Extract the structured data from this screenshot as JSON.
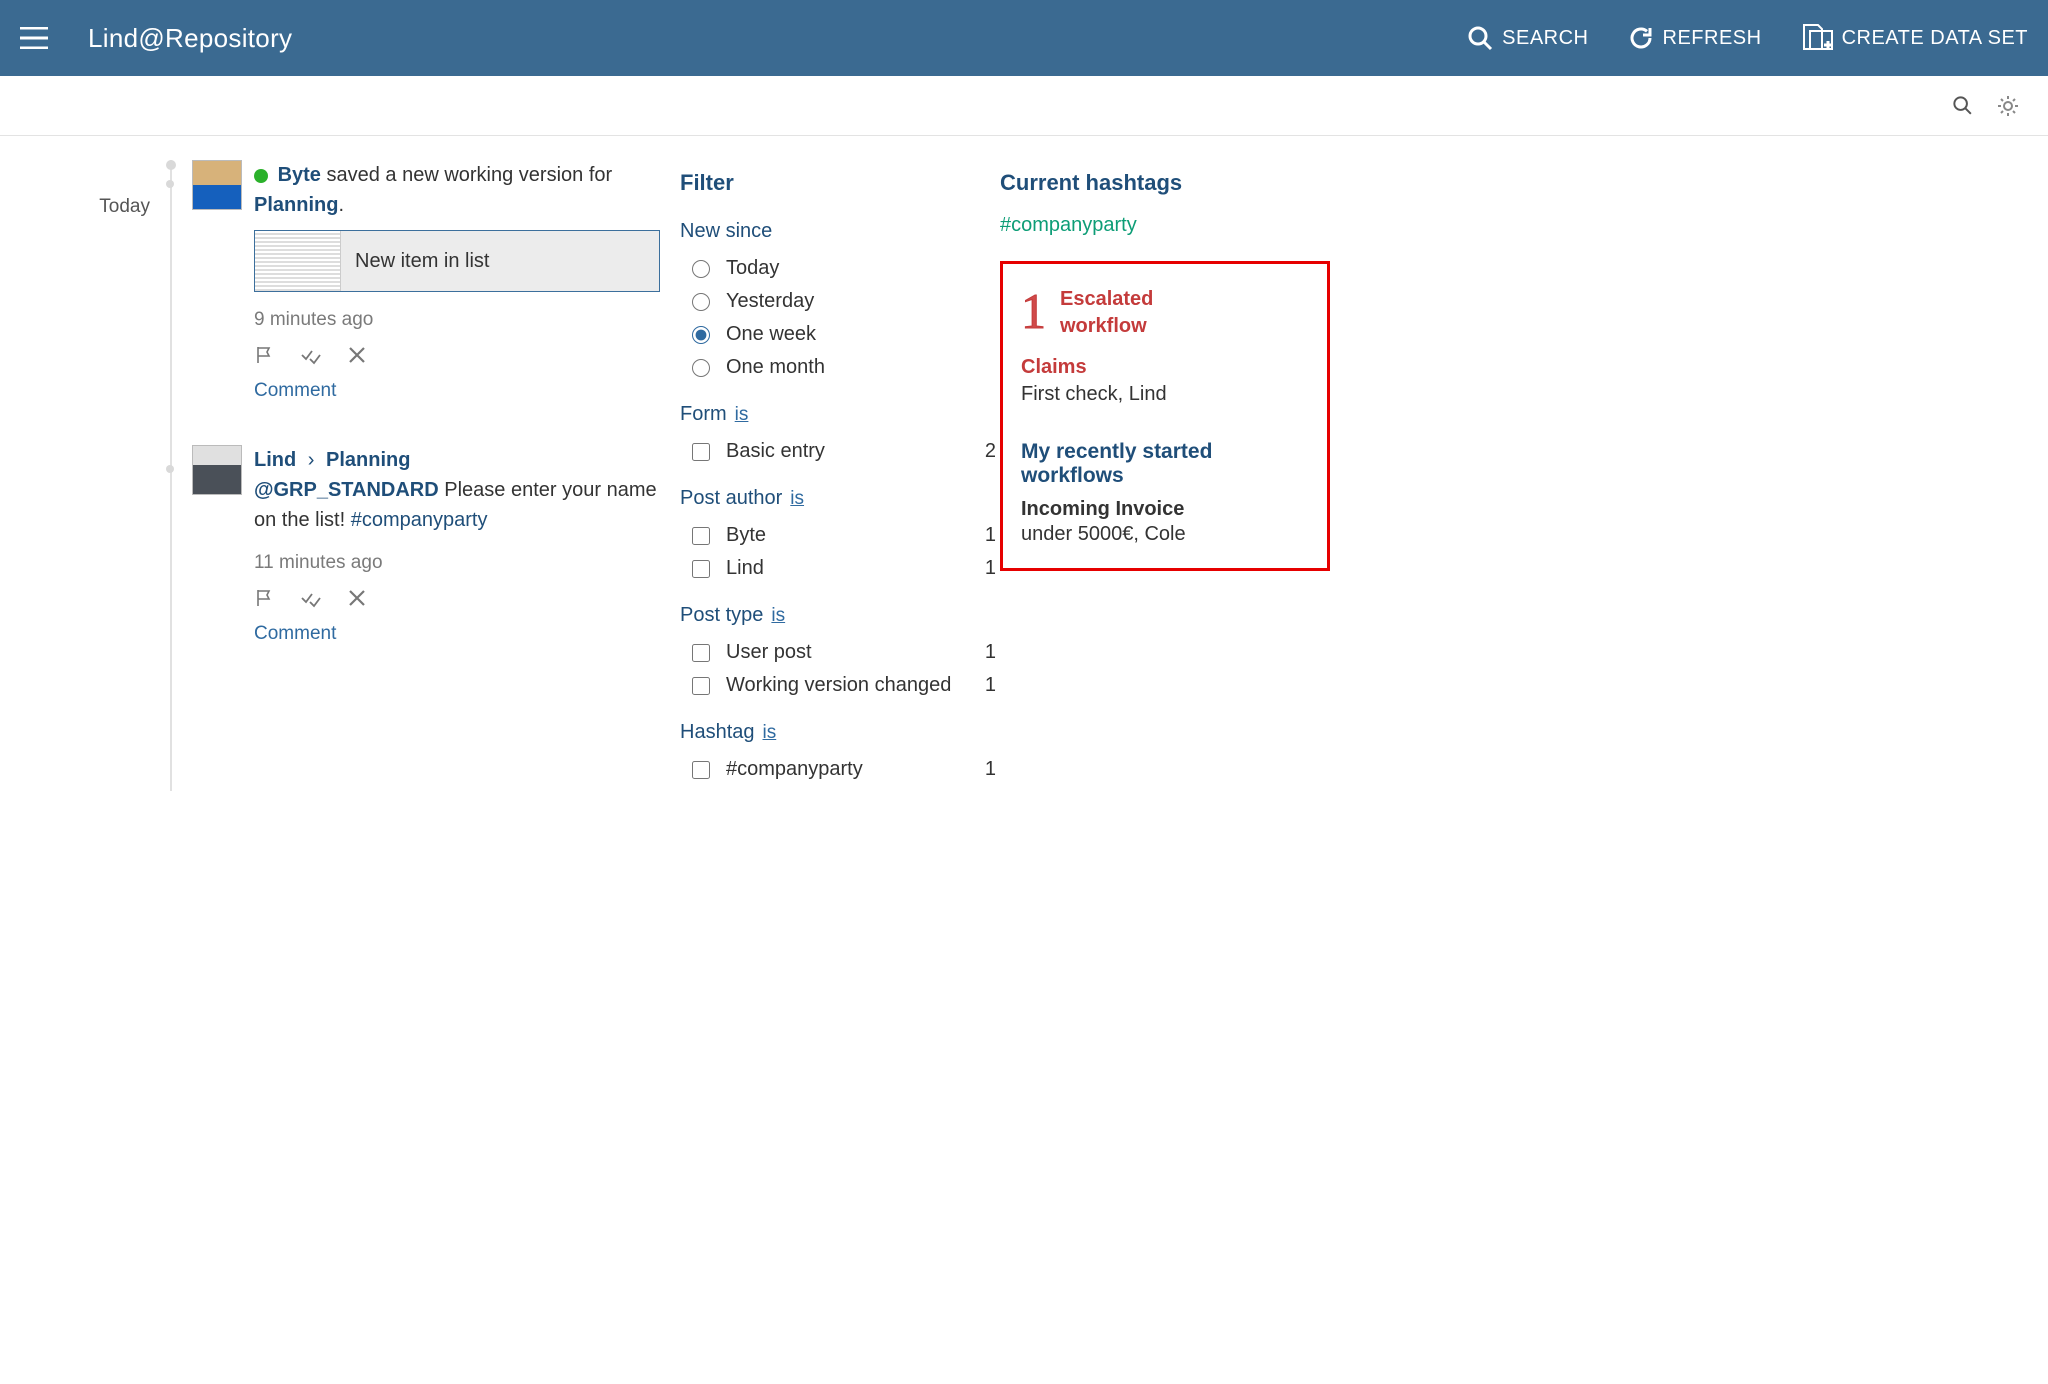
{
  "header": {
    "title": "Lind@Repository",
    "actions": {
      "search": "SEARCH",
      "refresh": "REFRESH",
      "create": "CREATE DATA SET"
    }
  },
  "timeline": {
    "label": "Today"
  },
  "posts": [
    {
      "user": "Byte",
      "action_text_1": " saved a new working version for ",
      "target": "Planning",
      "period": ".",
      "attachment_label": "New item in list",
      "time": "9 minutes ago",
      "comment_label": "Comment"
    },
    {
      "breadcrumb_user": "Lind",
      "breadcrumb_target": "Planning",
      "mention": "@GRP_STANDARD",
      "body_text": " Please enter your name on the list! ",
      "hashtag": "#companyparty",
      "time": "11 minutes ago",
      "comment_label": "Comment"
    }
  ],
  "filter": {
    "title": "Filter",
    "new_since": {
      "title": "New since",
      "options": [
        "Today",
        "Yesterday",
        "One week",
        "One month"
      ],
      "selected": "One week"
    },
    "form": {
      "title": "Form",
      "is": "is",
      "items": [
        {
          "label": "Basic entry",
          "count": "2"
        }
      ]
    },
    "post_author": {
      "title": "Post author",
      "is": "is",
      "items": [
        {
          "label": "Byte",
          "count": "1"
        },
        {
          "label": "Lind",
          "count": "1"
        }
      ]
    },
    "post_type": {
      "title": "Post type",
      "is": "is",
      "items": [
        {
          "label": "User post",
          "count": "1"
        },
        {
          "label": "Working version changed",
          "count": "1"
        }
      ]
    },
    "hashtag": {
      "title": "Hashtag",
      "is": "is",
      "items": [
        {
          "label": "#companyparty",
          "count": "1"
        }
      ]
    }
  },
  "side": {
    "hashtags_title": "Current hashtags",
    "hashtag": "#companyparty",
    "escalated": {
      "count": "1",
      "title_l1": "Escalated",
      "title_l2": "workflow",
      "subject": "Claims",
      "line": "First check,  Lind"
    },
    "my_workflows": {
      "title": "My recently started workflows",
      "name": "Incoming Invoice",
      "line": "under 5000€, Cole"
    }
  }
}
